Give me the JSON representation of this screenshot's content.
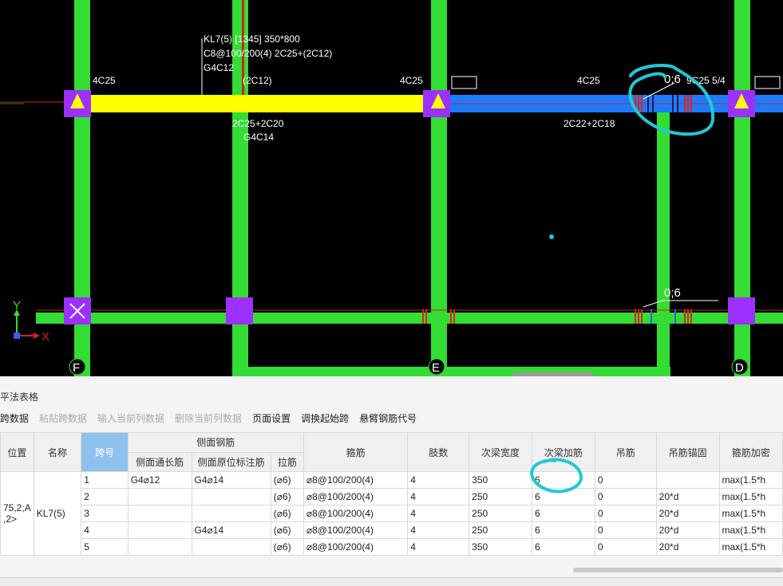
{
  "drawing": {
    "beam_callout_lines": [
      "KL7(5) [1345] 350*800",
      "C8@100/200(4) 2C25+(2C12)",
      "G4C12"
    ],
    "top_labels": [
      "4C25",
      "(2C12)",
      "4C25",
      "4C25"
    ],
    "bottom_labels": [
      "2C25+2C20",
      "G4C14",
      "2C22+2C18"
    ],
    "span_label_top": "0;6",
    "span_label_top_tail": "9C25 5/4",
    "span_label_bottom": "0;6",
    "axis_labels": [
      "F",
      "E",
      "D"
    ],
    "ucs_x": "X",
    "ucs_y": "Y",
    "colors": {
      "beam_selected": "#ffff00",
      "beam_blue": "#1e7bff",
      "column": "#9b30ff",
      "wall": "#33dd33",
      "annotation": "#20c8d8"
    }
  },
  "panel": {
    "title": "平法表格",
    "toolbar": [
      {
        "label": "跨数据",
        "enabled": true
      },
      {
        "label": "粘贴跨数据",
        "enabled": false
      },
      {
        "label": "输入当前列数据",
        "enabled": false
      },
      {
        "label": "删除当前列数据",
        "enabled": false
      },
      {
        "label": "页面设置",
        "enabled": true
      },
      {
        "label": "调换起始跨",
        "enabled": true
      },
      {
        "label": "悬臂钢筋代号",
        "enabled": true
      }
    ],
    "headers": {
      "position": "位置",
      "name": "名称",
      "span": "跨号",
      "side_group": "侧面钢筋",
      "side_through": "侧面通长筋",
      "side_marked": "侧面原位标注筋",
      "tie": "拉筋",
      "stirrup": "箍筋",
      "legs": "肢数",
      "sec_width": "次梁宽度",
      "sec_add": "次梁加筋",
      "hanger": "吊筋",
      "hanger_anchor": "吊筋锚固",
      "stirrup_dense": "箍筋加密"
    },
    "position_value_1": "75,2;A",
    "position_value_2": ",2>",
    "name_value": "KL7(5)",
    "rows": [
      {
        "span": "1",
        "side_through": "G4⌀12",
        "side_marked": "G4⌀14",
        "tie": "(⌀6)",
        "stirrup": "⌀8@100/200(4)",
        "legs": "4",
        "sec_width": "350",
        "sec_add": "6",
        "hanger": "0",
        "hanger_anchor": "",
        "stirrup_dense": "max(1.5*h"
      },
      {
        "span": "2",
        "side_through": "",
        "side_marked": "",
        "tie": "(⌀6)",
        "stirrup": "⌀8@100/200(4)",
        "legs": "4",
        "sec_width": "250",
        "sec_add": "6",
        "hanger": "0",
        "hanger_anchor": "20*d",
        "stirrup_dense": "max(1.5*h"
      },
      {
        "span": "3",
        "side_through": "",
        "side_marked": "",
        "tie": "(⌀6)",
        "stirrup": "⌀8@100/200(4)",
        "legs": "4",
        "sec_width": "250",
        "sec_add": "6",
        "hanger": "0",
        "hanger_anchor": "20*d",
        "stirrup_dense": "max(1.5*h"
      },
      {
        "span": "4",
        "side_through": "",
        "side_marked": "G4⌀14",
        "tie": "(⌀6)",
        "stirrup": "⌀8@100/200(4)",
        "legs": "4",
        "sec_width": "250",
        "sec_add": "6",
        "hanger": "0",
        "hanger_anchor": "20*d",
        "stirrup_dense": "max(1.5*h"
      },
      {
        "span": "5",
        "side_through": "",
        "side_marked": "",
        "tie": "(⌀6)",
        "stirrup": "⌀8@100/200(4)",
        "legs": "4",
        "sec_width": "350",
        "sec_add": "6",
        "hanger": "0",
        "hanger_anchor": "20*d",
        "stirrup_dense": "max(1.5*h"
      }
    ]
  }
}
